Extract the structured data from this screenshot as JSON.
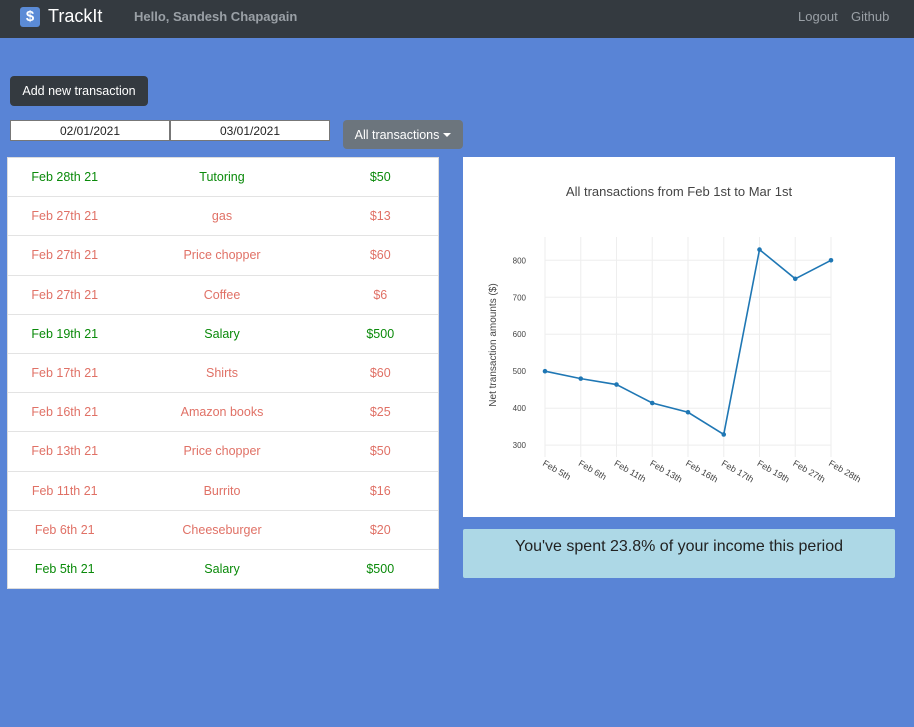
{
  "navbar": {
    "icon": "dollar-icon",
    "brand": "TrackIt",
    "greeting": "Hello, Sandesh Chapagain",
    "links": [
      "Logout",
      "Github"
    ]
  },
  "controls": {
    "add_label": "Add new transaction",
    "start_date": "02/01/2021",
    "end_date": "03/01/2021",
    "filter_label": "All transactions"
  },
  "colors": {
    "income": "#0a8a0a",
    "expense": "#e07166",
    "line": "#1f77b4"
  },
  "transactions": [
    {
      "date": "Feb 28th 21",
      "desc": "Tutoring",
      "amount": "$50",
      "type": "income"
    },
    {
      "date": "Feb 27th 21",
      "desc": "gas",
      "amount": "$13",
      "type": "expense"
    },
    {
      "date": "Feb 27th 21",
      "desc": "Price chopper",
      "amount": "$60",
      "type": "expense"
    },
    {
      "date": "Feb 27th 21",
      "desc": "Coffee",
      "amount": "$6",
      "type": "expense"
    },
    {
      "date": "Feb 19th 21",
      "desc": "Salary",
      "amount": "$500",
      "type": "income"
    },
    {
      "date": "Feb 17th 21",
      "desc": "Shirts",
      "amount": "$60",
      "type": "expense"
    },
    {
      "date": "Feb 16th 21",
      "desc": "Amazon books",
      "amount": "$25",
      "type": "expense"
    },
    {
      "date": "Feb 13th 21",
      "desc": "Price chopper",
      "amount": "$50",
      "type": "expense"
    },
    {
      "date": "Feb 11th 21",
      "desc": "Burrito",
      "amount": "$16",
      "type": "expense"
    },
    {
      "date": "Feb 6th 21",
      "desc": "Cheeseburger",
      "amount": "$20",
      "type": "expense"
    },
    {
      "date": "Feb 5th 21",
      "desc": "Salary",
      "amount": "$500",
      "type": "income"
    }
  ],
  "chart_data": {
    "type": "line",
    "title": "All transactions from Feb 1st to Mar 1st",
    "xlabel": "",
    "ylabel": "Net transaction amounts ($)",
    "categories": [
      "Feb 5th",
      "Feb 6th",
      "Feb 11th",
      "Feb 13th",
      "Feb 16th",
      "Feb 17th",
      "Feb 19th",
      "Feb 27th",
      "Feb 28th"
    ],
    "values": [
      500,
      480,
      464,
      414,
      389,
      329,
      829,
      750,
      800
    ],
    "yticks": [
      300,
      400,
      500,
      600,
      700,
      800
    ],
    "ylim": [
      268,
      863
    ],
    "grid": true
  },
  "summary": "You've spent 23.8% of your income this period"
}
